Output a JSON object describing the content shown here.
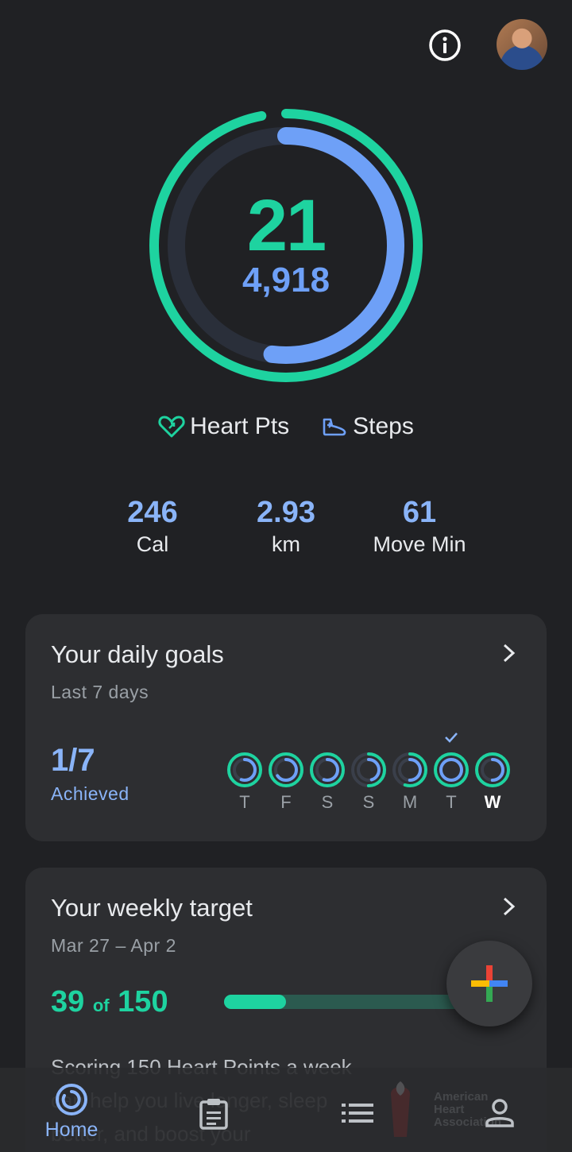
{
  "header": {
    "info_icon": "info-icon",
    "avatar": "avatar"
  },
  "rings": {
    "heart_points": 21,
    "heart_points_display": "21",
    "steps": 4918,
    "steps_display": "4,918",
    "heart_progress": 0.97,
    "steps_progress": 0.52,
    "colors": {
      "heart": "#1ed3a0",
      "steps": "#6ea0f7",
      "track": "#2a2f3a"
    }
  },
  "legend": {
    "heart_label": "Heart Pts",
    "steps_label": "Steps"
  },
  "stats": [
    {
      "value": "246",
      "label": "Cal"
    },
    {
      "value": "2.93",
      "label": "km"
    },
    {
      "value": "61",
      "label": "Move Min"
    }
  ],
  "daily_goals": {
    "title": "Your daily goals",
    "subtitle": "Last 7 days",
    "achieved_value": "1/7",
    "achieved_label": "Achieved",
    "days": [
      {
        "label": "T",
        "heart": 1.0,
        "steps": 0.55,
        "check": false
      },
      {
        "label": "F",
        "heart": 1.0,
        "steps": 0.65,
        "check": false
      },
      {
        "label": "S",
        "heart": 1.0,
        "steps": 0.55,
        "check": false
      },
      {
        "label": "S",
        "heart": 0.5,
        "steps": 0.45,
        "check": false
      },
      {
        "label": "M",
        "heart": 0.55,
        "steps": 0.5,
        "check": false
      },
      {
        "label": "T",
        "heart": 1.0,
        "steps": 1.0,
        "check": true
      },
      {
        "label": "W",
        "heart": 1.0,
        "steps": 0.5,
        "check": false,
        "today": true
      }
    ]
  },
  "weekly_target": {
    "title": "Your weekly target",
    "subtitle": "Mar 27 – Apr 2",
    "value": "39",
    "of_word": "of",
    "target": "150",
    "progress": 0.26,
    "description": "Scoring 150 Heart Points a week can help you live longer, sleep better, and boost your"
  },
  "fab": {
    "icon": "plus-icon"
  },
  "nav": {
    "home_label": "Home",
    "aha_text": [
      "American",
      "Heart",
      "Association"
    ]
  }
}
